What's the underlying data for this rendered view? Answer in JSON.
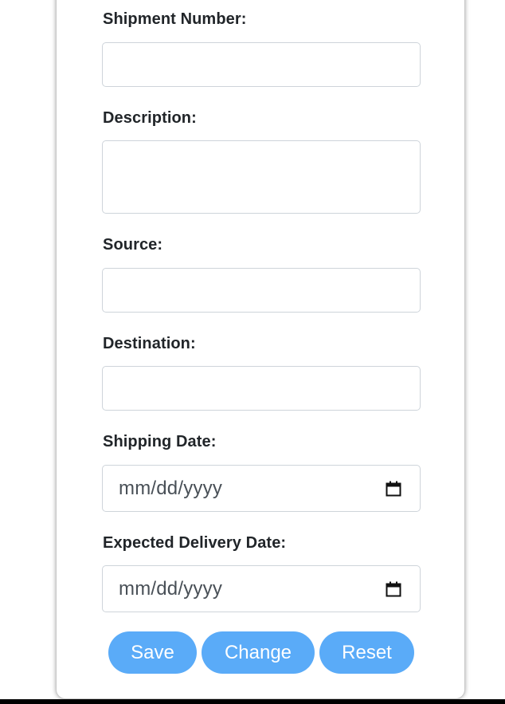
{
  "form": {
    "shipment_number": {
      "label": "Shipment Number:",
      "value": ""
    },
    "description": {
      "label": "Description:",
      "value": ""
    },
    "source": {
      "label": "Source:",
      "value": ""
    },
    "destination": {
      "label": "Destination:",
      "value": ""
    },
    "shipping_date": {
      "label": "Shipping Date:",
      "placeholder": "mm/dd/yyyy",
      "icon": "calendar-icon"
    },
    "expected_delivery_date": {
      "label": "Expected Delivery Date:",
      "placeholder": "mm/dd/yyyy",
      "icon": "calendar-icon"
    }
  },
  "buttons": {
    "save": "Save",
    "change": "Change",
    "reset": "Reset"
  },
  "colors": {
    "button_bg": "#5aabf8",
    "button_text": "#ffffff",
    "input_border": "#ced4da",
    "label_text": "#212529"
  }
}
